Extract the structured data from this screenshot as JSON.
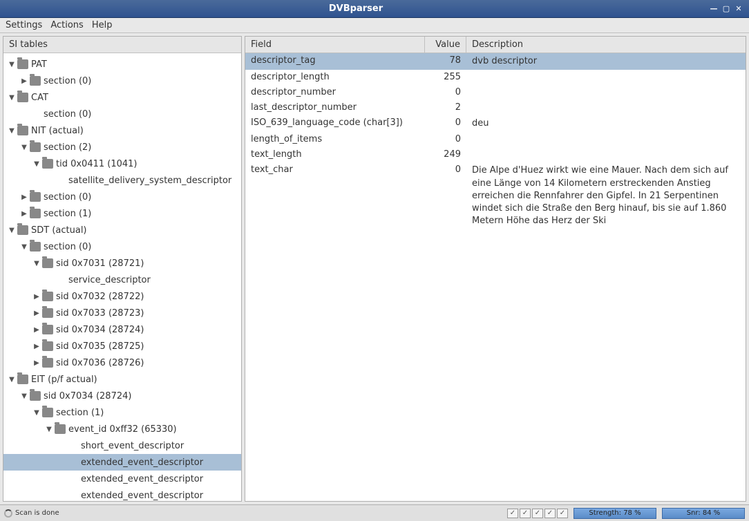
{
  "window": {
    "title": "DVBparser"
  },
  "menu": {
    "settings": "Settings",
    "actions": "Actions",
    "help": "Help"
  },
  "sidebar": {
    "header": "SI tables"
  },
  "tree": [
    {
      "depth": 0,
      "toggle": "down",
      "folder": true,
      "label": "PAT"
    },
    {
      "depth": 1,
      "toggle": "right",
      "folder": true,
      "label": "section (0)"
    },
    {
      "depth": 0,
      "toggle": "down",
      "folder": true,
      "label": "CAT"
    },
    {
      "depth": 1,
      "toggle": "",
      "folder": false,
      "label": "section (0)"
    },
    {
      "depth": 0,
      "toggle": "down",
      "folder": true,
      "label": "NIT (actual)"
    },
    {
      "depth": 1,
      "toggle": "down",
      "folder": true,
      "label": "section (2)"
    },
    {
      "depth": 2,
      "toggle": "down",
      "folder": true,
      "label": "tid 0x0411 (1041)"
    },
    {
      "depth": 3,
      "toggle": "",
      "folder": false,
      "label": "satellite_delivery_system_descriptor"
    },
    {
      "depth": 1,
      "toggle": "right",
      "folder": true,
      "label": "section (0)"
    },
    {
      "depth": 1,
      "toggle": "right",
      "folder": true,
      "label": "section (1)"
    },
    {
      "depth": 0,
      "toggle": "down",
      "folder": true,
      "label": "SDT (actual)"
    },
    {
      "depth": 1,
      "toggle": "down",
      "folder": true,
      "label": "section (0)"
    },
    {
      "depth": 2,
      "toggle": "down",
      "folder": true,
      "label": "sid 0x7031 (28721)"
    },
    {
      "depth": 3,
      "toggle": "",
      "folder": false,
      "label": "service_descriptor"
    },
    {
      "depth": 2,
      "toggle": "right",
      "folder": true,
      "label": "sid 0x7032 (28722)"
    },
    {
      "depth": 2,
      "toggle": "right",
      "folder": true,
      "label": "sid 0x7033 (28723)"
    },
    {
      "depth": 2,
      "toggle": "right",
      "folder": true,
      "label": "sid 0x7034 (28724)"
    },
    {
      "depth": 2,
      "toggle": "right",
      "folder": true,
      "label": "sid 0x7035 (28725)"
    },
    {
      "depth": 2,
      "toggle": "right",
      "folder": true,
      "label": "sid 0x7036 (28726)"
    },
    {
      "depth": 0,
      "toggle": "down",
      "folder": true,
      "label": "EIT (p/f actual)"
    },
    {
      "depth": 1,
      "toggle": "down",
      "folder": true,
      "label": "sid 0x7034 (28724)"
    },
    {
      "depth": 2,
      "toggle": "down",
      "folder": true,
      "label": "section (1)"
    },
    {
      "depth": 3,
      "toggle": "down",
      "folder": true,
      "label": "event_id 0xff32 (65330)"
    },
    {
      "depth": 4,
      "toggle": "",
      "folder": false,
      "label": "short_event_descriptor"
    },
    {
      "depth": 4,
      "toggle": "",
      "folder": false,
      "label": "extended_event_descriptor",
      "selected": true
    },
    {
      "depth": 4,
      "toggle": "",
      "folder": false,
      "label": "extended_event_descriptor"
    },
    {
      "depth": 4,
      "toggle": "",
      "folder": false,
      "label": "extended_event_descriptor"
    }
  ],
  "table": {
    "headers": {
      "field": "Field",
      "value": "Value",
      "description": "Description"
    },
    "rows": [
      {
        "field": "descriptor_tag",
        "value": "78",
        "desc": "dvb descriptor",
        "selected": true
      },
      {
        "field": "descriptor_length",
        "value": "255",
        "desc": ""
      },
      {
        "field": "descriptor_number",
        "value": "0",
        "desc": ""
      },
      {
        "field": "last_descriptor_number",
        "value": "2",
        "desc": ""
      },
      {
        "field": "ISO_639_language_code (char[3])",
        "value": "0",
        "desc": "deu"
      },
      {
        "field": "length_of_items",
        "value": "0",
        "desc": ""
      },
      {
        "field": "text_length",
        "value": "249",
        "desc": ""
      },
      {
        "field": "text_char",
        "value": "0",
        "desc": "Die Alpe d'Huez wirkt wie eine Mauer. Nach dem sich auf eine Länge von 14 Kilometern erstreckenden Anstieg erreichen die Rennfahrer den Gipfel. In 21 Serpentinen windet sich die Straße den Berg hinauf, bis sie auf 1.860 Metern Höhe das Herz der Ski"
      }
    ]
  },
  "status": {
    "scan": "Scan is done",
    "strength": "Strength: 78 %",
    "snr": "Snr: 84 %"
  }
}
